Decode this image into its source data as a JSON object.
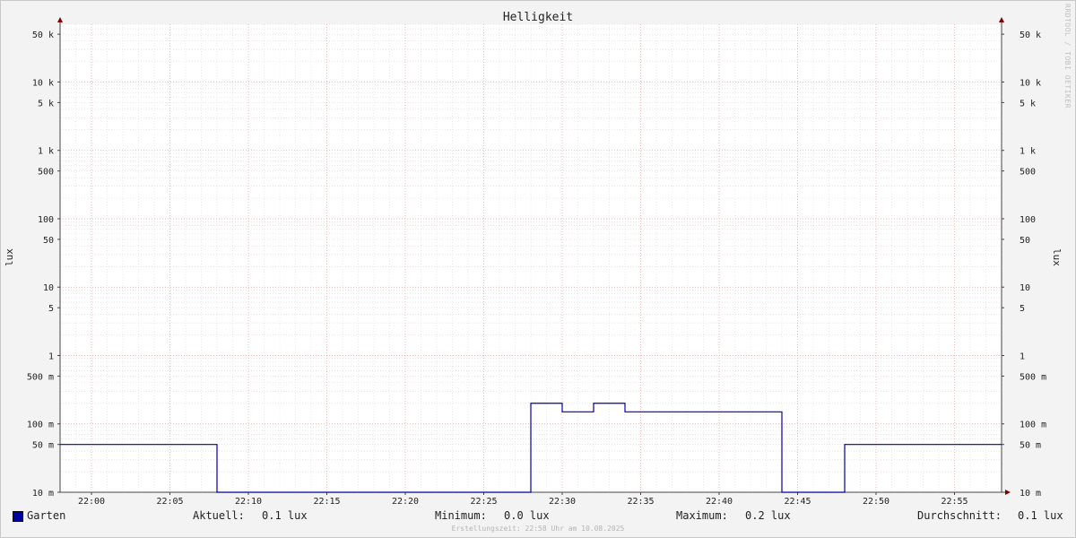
{
  "chart_data": {
    "type": "line",
    "title": "Helligkeit",
    "ylabel": "lux",
    "y_scale": "log",
    "ylim": [
      0.01,
      70000
    ],
    "x_range": [
      "21:58",
      "22:58"
    ],
    "x_ticks": [
      "22:00",
      "22:05",
      "22:10",
      "22:15",
      "22:20",
      "22:25",
      "22:30",
      "22:35",
      "22:40",
      "22:45",
      "22:50",
      "22:55"
    ],
    "y_ticks": [
      {
        "value": 50000,
        "label": "50 k"
      },
      {
        "value": 10000,
        "label": "10 k"
      },
      {
        "value": 5000,
        "label": "5 k"
      },
      {
        "value": 1000,
        "label": "1 k"
      },
      {
        "value": 500,
        "label": "500"
      },
      {
        "value": 100,
        "label": "100"
      },
      {
        "value": 50,
        "label": "50"
      },
      {
        "value": 10,
        "label": "10"
      },
      {
        "value": 5,
        "label": "5"
      },
      {
        "value": 1,
        "label": "1"
      },
      {
        "value": 0.5,
        "label": "500 m"
      },
      {
        "value": 0.1,
        "label": "100 m"
      },
      {
        "value": 0.05,
        "label": "50 m"
      },
      {
        "value": 0.01,
        "label": "10 m"
      }
    ],
    "grid": true,
    "series": [
      {
        "name": "Garten",
        "color": "#0000a0",
        "step": true,
        "points": [
          [
            "21:58",
            0.05
          ],
          [
            "22:08",
            0.05
          ],
          [
            "22:08",
            0.01
          ],
          [
            "22:28",
            0.01
          ],
          [
            "22:28",
            0.2
          ],
          [
            "22:30",
            0.2
          ],
          [
            "22:30",
            0.15
          ],
          [
            "22:32",
            0.15
          ],
          [
            "22:32",
            0.2
          ],
          [
            "22:34",
            0.2
          ],
          [
            "22:34",
            0.15
          ],
          [
            "22:44",
            0.15
          ],
          [
            "22:44",
            0.01
          ],
          [
            "22:48",
            0.01
          ],
          [
            "22:48",
            0.05
          ],
          [
            "22:58",
            0.05
          ]
        ]
      }
    ]
  },
  "legend": {
    "series_name": "Garten",
    "series_color": "#0000a0",
    "current_label": "Aktuell:",
    "current_value": "0.1 lux",
    "min_label": "Minimum:",
    "min_value": "0.0 lux",
    "max_label": "Maximum:",
    "max_value": "0.2 lux",
    "avg_label": "Durchschnitt:",
    "avg_value": "0.1 lux"
  },
  "footer": "Erstellungszeit: 22:58 Uhr am 10.08.2025",
  "watermark": "RRDTOOL / TOBI OETIKER"
}
